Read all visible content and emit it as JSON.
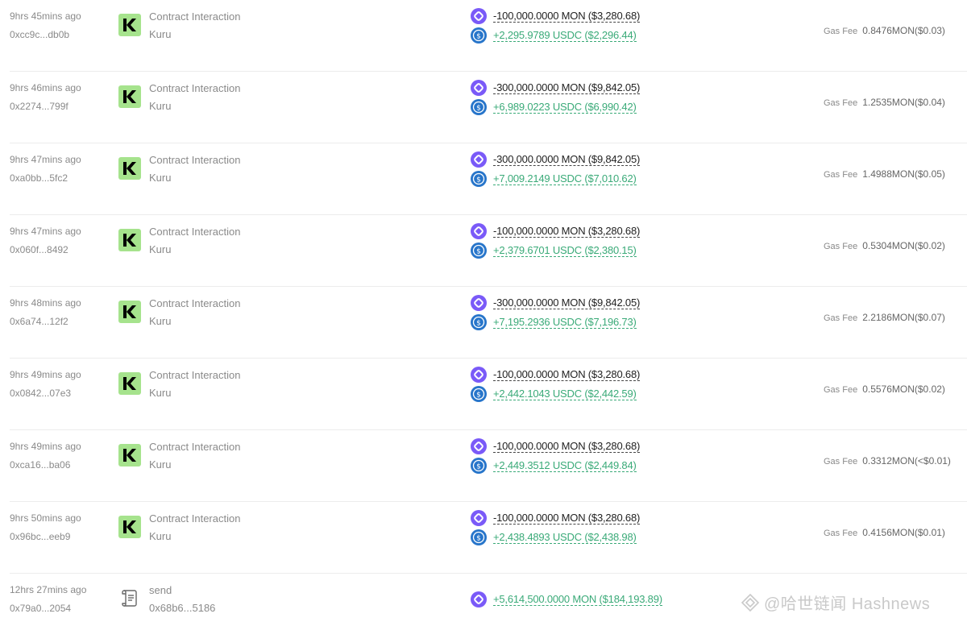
{
  "colors": {
    "mon": "#7a5af8",
    "usdc": "#2775ca",
    "positive": "#3aaa78",
    "kuru_bg": "#a6e38d"
  },
  "rows": [
    {
      "time": "9hrs 45mins ago",
      "hash": "0xcc9c...db0b",
      "method": "Contract Interaction",
      "app": "Kuru",
      "icon": "kuru-logo",
      "out": "-100,000.0000 MON ($3,280.68)",
      "in": "+2,295.9789 USDC ($2,296.44)",
      "gas_label": "Gas Fee",
      "gas": "0.8476MON($0.03)"
    },
    {
      "time": "9hrs 46mins ago",
      "hash": "0x2274...799f",
      "method": "Contract Interaction",
      "app": "Kuru",
      "icon": "kuru-logo",
      "out": "-300,000.0000 MON ($9,842.05)",
      "in": "+6,989.0223 USDC ($6,990.42)",
      "gas_label": "Gas Fee",
      "gas": "1.2535MON($0.04)"
    },
    {
      "time": "9hrs 47mins ago",
      "hash": "0xa0bb...5fc2",
      "method": "Contract Interaction",
      "app": "Kuru",
      "icon": "kuru-logo",
      "out": "-300,000.0000 MON ($9,842.05)",
      "in": "+7,009.2149 USDC ($7,010.62)",
      "gas_label": "Gas Fee",
      "gas": "1.4988MON($0.05)"
    },
    {
      "time": "9hrs 47mins ago",
      "hash": "0x060f...8492",
      "method": "Contract Interaction",
      "app": "Kuru",
      "icon": "kuru-logo",
      "out": "-100,000.0000 MON ($3,280.68)",
      "in": "+2,379.6701 USDC ($2,380.15)",
      "gas_label": "Gas Fee",
      "gas": "0.5304MON($0.02)"
    },
    {
      "time": "9hrs 48mins ago",
      "hash": "0x6a74...12f2",
      "method": "Contract Interaction",
      "app": "Kuru",
      "icon": "kuru-logo",
      "out": "-300,000.0000 MON ($9,842.05)",
      "in": "+7,195.2936 USDC ($7,196.73)",
      "gas_label": "Gas Fee",
      "gas": "2.2186MON($0.07)"
    },
    {
      "time": "9hrs 49mins ago",
      "hash": "0x0842...07e3",
      "method": "Contract Interaction",
      "app": "Kuru",
      "icon": "kuru-logo",
      "out": "-100,000.0000 MON ($3,280.68)",
      "in": "+2,442.1043 USDC ($2,442.59)",
      "gas_label": "Gas Fee",
      "gas": "0.5576MON($0.02)"
    },
    {
      "time": "9hrs 49mins ago",
      "hash": "0xca16...ba06",
      "method": "Contract Interaction",
      "app": "Kuru",
      "icon": "kuru-logo",
      "out": "-100,000.0000 MON ($3,280.68)",
      "in": "+2,449.3512 USDC ($2,449.84)",
      "gas_label": "Gas Fee",
      "gas": "0.3312MON(<$0.01)"
    },
    {
      "time": "9hrs 50mins ago",
      "hash": "0x96bc...eeb9",
      "method": "Contract Interaction",
      "app": "Kuru",
      "icon": "kuru-logo",
      "out": "-100,000.0000 MON ($3,280.68)",
      "in": "+2,438.4893 USDC ($2,438.98)",
      "gas_label": "Gas Fee",
      "gas": "0.4156MON($0.01)"
    },
    {
      "time": "12hrs 27mins ago",
      "hash": "0x79a0...2054",
      "method": "send",
      "app": "0x68b6...5186",
      "icon": "document-icon",
      "in_mon": "+5,614,500.0000 MON ($184,193.89)"
    }
  ],
  "watermark": {
    "text": "@哈世链闻 Hashnews",
    "icon": "diamond-logo-icon"
  }
}
